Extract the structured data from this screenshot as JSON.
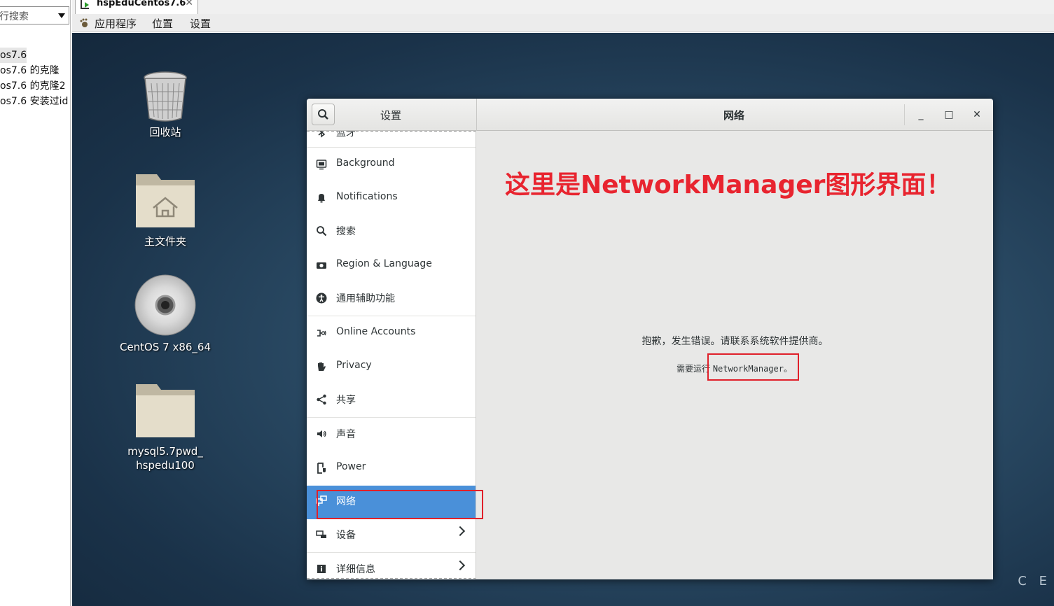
{
  "library": {
    "search_text": "行搜索",
    "items": [
      "os7.6",
      "os7.6 的克隆",
      "os7.6 的克隆2",
      "os7.6 安装过id"
    ]
  },
  "vm_tab": {
    "label": "hspEduCentos7.6",
    "close": "✕"
  },
  "guest_menu": {
    "applications": "应用程序",
    "places": "位置",
    "settings": "设置"
  },
  "desktop": {
    "icons": [
      {
        "label": "回收站"
      },
      {
        "label": "主文件夹"
      },
      {
        "label": "CentOS 7 x86_64"
      },
      {
        "label_line1": "mysql5.7pwd_",
        "label_line2": "hspedu100"
      }
    ],
    "corner_text": "C E"
  },
  "settings_window": {
    "sidebar_title": "设置",
    "page_title": "网络",
    "controls": {
      "minimize": "_",
      "maximize": "□",
      "close": "✕"
    },
    "sidebar_items": [
      {
        "label": "蓝牙",
        "icon": "bluetooth-icon"
      },
      {
        "label": "Background",
        "icon": "background-icon"
      },
      {
        "label": "Notifications",
        "icon": "bell-icon"
      },
      {
        "label": "搜索",
        "icon": "search-icon"
      },
      {
        "label": "Region & Language",
        "icon": "camera-icon"
      },
      {
        "label": "通用辅助功能",
        "icon": "accessibility-icon"
      },
      {
        "label": "Online Accounts",
        "icon": "online-accounts-icon"
      },
      {
        "label": "Privacy",
        "icon": "hand-icon"
      },
      {
        "label": "共享",
        "icon": "share-icon"
      },
      {
        "label": "声音",
        "icon": "speaker-icon"
      },
      {
        "label": "Power",
        "icon": "power-icon"
      },
      {
        "label": "网络",
        "icon": "network-icon",
        "selected": true
      },
      {
        "label": "设备",
        "icon": "devices-icon",
        "has_submenu": true
      },
      {
        "label": "详细信息",
        "icon": "info-icon",
        "has_submenu": true
      }
    ],
    "annotation": "这里是NetworkManager图形界面！",
    "error_message": "抱歉，发生错误。请联系系统软件提供商。",
    "requirement_prefix": "需要运行 ",
    "requirement_mono": "NetworkManager",
    "requirement_suffix": "。"
  },
  "colors": {
    "accent": "#4a90d9",
    "annotation_red": "#e8242f",
    "desktop_bg": "#1f3a53"
  }
}
